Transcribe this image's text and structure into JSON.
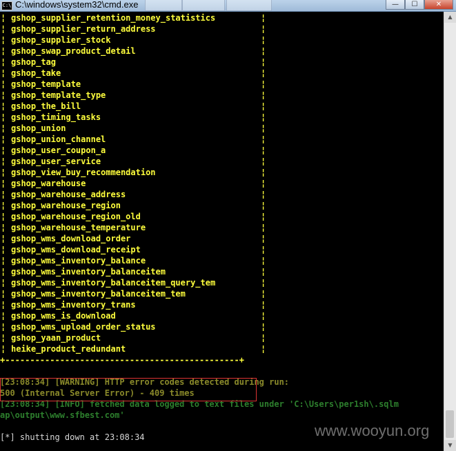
{
  "window": {
    "title": "C:\\windows\\system32\\cmd.exe",
    "icon_text": "C:\\",
    "buttons": {
      "minimize": "—",
      "maximize": "☐",
      "close": "✕"
    }
  },
  "table": {
    "border_char": "¦",
    "bottom_border": "+-----------------------------------------------+",
    "rows": [
      "gshop_supplier_retention_money_statistics",
      "gshop_supplier_return_address",
      "gshop_supplier_stock",
      "gshop_swap_product_detail",
      "gshop_tag",
      "gshop_take",
      "gshop_template",
      "gshop_template_type",
      "gshop_the_bill",
      "gshop_timing_tasks",
      "gshop_union",
      "gshop_union_channel",
      "gshop_user_coupon_a",
      "gshop_user_service",
      "gshop_view_buy_recommendation",
      "gshop_warehouse",
      "gshop_warehouse_address",
      "gshop_warehouse_region",
      "gshop_warehouse_region_old",
      "gshop_warehouse_temperature",
      "gshop_wms_download_order",
      "gshop_wms_download_receipt",
      "gshop_wms_inventory_balance",
      "gshop_wms_inventory_balanceitem",
      "gshop_wms_inventory_balanceitem_query_tem",
      "gshop_wms_inventory_balanceitem_tem",
      "gshop_wms_inventory_trans",
      "gshop_wms_is_download",
      "gshop_wms_upload_order_status",
      "gshop_yaan_product",
      "heike_product_redundant"
    ]
  },
  "log": {
    "warning": "[23:08:34] [WARNING] HTTP error codes detected during run:",
    "error_code": "500 (Internal Server Error) - 409 times",
    "info_1": "[23:08:34] [INFO] fetched data logged to text files under 'C:\\Users\\per1sh\\.sqlm",
    "info_2": "ap\\output\\www.sfbest.com'",
    "shutdown": "[*] shutting down at 23:08:34"
  },
  "watermark": "www.wooyun.org",
  "scrollbar": {
    "up": "▲",
    "down": "▼"
  }
}
